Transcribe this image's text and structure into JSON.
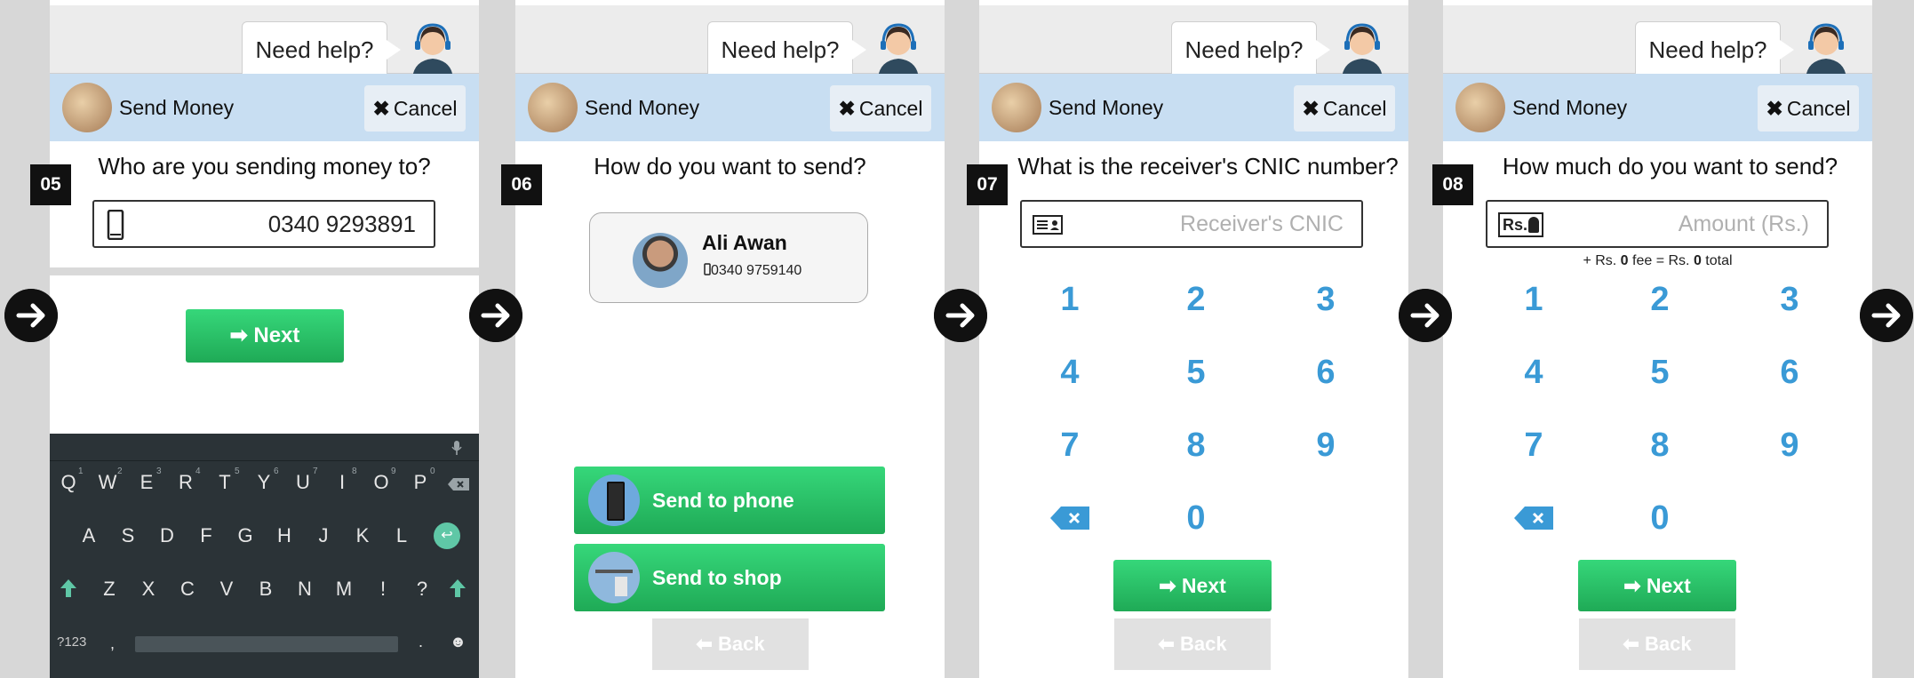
{
  "help": {
    "label": "Need help?"
  },
  "header": {
    "title": "Send Money",
    "cancel_label": "Cancel"
  },
  "steps": [
    {
      "badge": "05",
      "question": "Who are you sending money to?",
      "phone_value": "0340 9293891",
      "next_label": "Next",
      "keyboard": {
        "row1": [
          "Q",
          "W",
          "E",
          "R",
          "T",
          "Y",
          "U",
          "I",
          "O",
          "P"
        ],
        "row1_numbers": [
          "1",
          "2",
          "3",
          "4",
          "5",
          "6",
          "7",
          "8",
          "9",
          "0"
        ],
        "row2": [
          "A",
          "S",
          "D",
          "F",
          "G",
          "H",
          "J",
          "K",
          "L"
        ],
        "row3": [
          "Z",
          "X",
          "C",
          "V",
          "B",
          "N",
          "M",
          "!",
          "?"
        ],
        "symbols_label": "?123",
        "comma": ",",
        "period": "."
      }
    },
    {
      "badge": "06",
      "question": "How do you want to send?",
      "contact_name": "Ali Awan",
      "contact_phone": "0340 9759140",
      "send_phone_label": "Send to phone",
      "send_shop_label": "Send to shop",
      "back_label": "Back"
    },
    {
      "badge": "07",
      "question": "What is the receiver's CNIC number?",
      "placeholder": "Receiver's CNIC",
      "keypad": [
        "1",
        "2",
        "3",
        "4",
        "5",
        "6",
        "7",
        "8",
        "9",
        "0"
      ],
      "next_label": "Next",
      "back_label": "Back"
    },
    {
      "badge": "08",
      "question": "How much do you want to send?",
      "currency_icon_label": "Rs.",
      "placeholder": "Amount (Rs.)",
      "fee_prefix": "+ Rs. ",
      "fee_amount": "0",
      "fee_middle": " fee = Rs. ",
      "total_amount": "0",
      "fee_suffix": " total",
      "keypad": [
        "1",
        "2",
        "3",
        "4",
        "5",
        "6",
        "7",
        "8",
        "9",
        "0"
      ],
      "next_label": "Next",
      "back_label": "Back"
    }
  ],
  "colors": {
    "accent_green": "#2ccd6d",
    "header_blue": "#c8def2",
    "keypad_blue": "#3a9ad6"
  }
}
